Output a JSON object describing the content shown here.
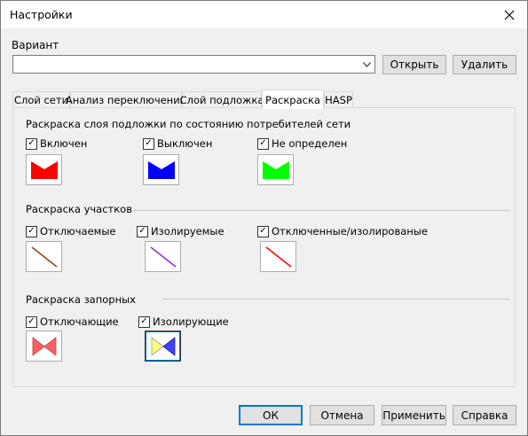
{
  "window": {
    "title": "Настройки"
  },
  "variant": {
    "label": "Вариант",
    "value": "",
    "open_label": "Открыть",
    "delete_label": "Удалить"
  },
  "tabs": [
    {
      "label": "Слой сети"
    },
    {
      "label": "Анализ переключений"
    },
    {
      "label": "Слой подложка"
    },
    {
      "label": "Раскраска"
    },
    {
      "label": "HASP"
    }
  ],
  "active_tab": "Раскраска",
  "consumer_section": {
    "title": "Раскраска слоя подложки по состоянию потребителей сети",
    "items": [
      {
        "label": "Включен",
        "checked": true,
        "color": "#ff0000"
      },
      {
        "label": "Выключен",
        "checked": true,
        "color": "#0000ff"
      },
      {
        "label": "Не определен",
        "checked": true,
        "color": "#00ff00"
      }
    ]
  },
  "segments_section": {
    "title": "Раскраска участков",
    "items": [
      {
        "label": "Отключаемые",
        "checked": true,
        "color": "#8b4513"
      },
      {
        "label": "Изолируемые",
        "checked": true,
        "color": "#8a2be2"
      },
      {
        "label": "Отключенные/изолированые",
        "checked": true,
        "color": "#ff0000"
      }
    ]
  },
  "valves_section": {
    "title": "Раскраска запорных",
    "items": [
      {
        "label": "Отключающие",
        "checked": true,
        "color_left": "#ff6060",
        "color_right": "#ff6060"
      },
      {
        "label": "Изолирующие",
        "checked": true,
        "color_left": "#ffff80",
        "color_right": "#4040ff"
      }
    ]
  },
  "footer": {
    "ok_label": "ОК",
    "cancel_label": "Отмена",
    "apply_label": "Применить",
    "help_label": "Справка"
  },
  "check_mark": "✓",
  "icons": {
    "close": "close-icon",
    "dropdown": "chevron-down-icon"
  }
}
